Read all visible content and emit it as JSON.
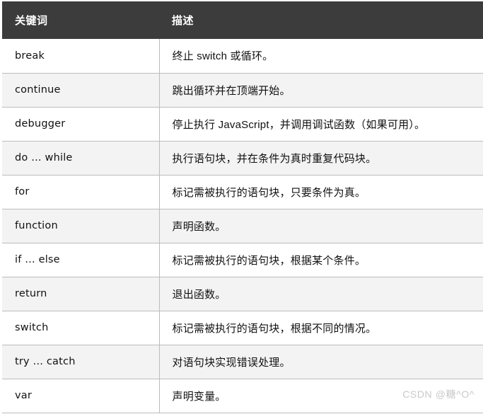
{
  "table": {
    "columns": [
      {
        "key": "keyword",
        "label": "关键词"
      },
      {
        "key": "description",
        "label": "描述"
      }
    ],
    "rows": [
      {
        "keyword": "break",
        "description": "终止 switch 或循环。"
      },
      {
        "keyword": "continue",
        "description": "跳出循环并在顶端开始。"
      },
      {
        "keyword": "debugger",
        "description": "停止执行 JavaScript，并调用调试函数（如果可用）。"
      },
      {
        "keyword": "do ... while",
        "description": "执行语句块，并在条件为真时重复代码块。"
      },
      {
        "keyword": "for",
        "description": "标记需被执行的语句块，只要条件为真。"
      },
      {
        "keyword": "function",
        "description": "声明函数。"
      },
      {
        "keyword": "if ... else",
        "description": "标记需被执行的语句块，根据某个条件。"
      },
      {
        "keyword": "return",
        "description": "退出函数。"
      },
      {
        "keyword": "switch",
        "description": "标记需被执行的语句块，根据不同的情况。"
      },
      {
        "keyword": "try ... catch",
        "description": "对语句块实现错误处理。"
      },
      {
        "keyword": "var",
        "description": "声明变量。"
      }
    ]
  },
  "watermark": {
    "text": "CSDN @糖^O^"
  },
  "colors": {
    "header_background": "#3c3c3c",
    "header_text": "#ffffff",
    "row_odd_background": "#ffffff",
    "row_even_background": "#f3f3f3",
    "border": "#bcbcbc",
    "body_text": "#111111",
    "watermark_text": "#c9c9c9"
  }
}
